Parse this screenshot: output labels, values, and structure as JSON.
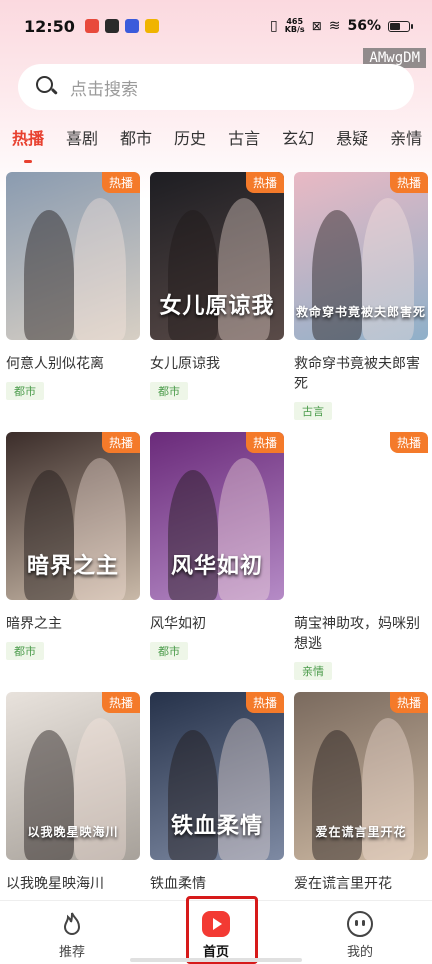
{
  "status_bar": {
    "time": "12:50",
    "net_speed_value": "465",
    "net_speed_unit": "KB/s",
    "battery_percent": "56%",
    "battery_level": 0.56
  },
  "watermark": "AMwgDM",
  "search": {
    "placeholder": "点击搜索"
  },
  "tabs": [
    "热播",
    "喜剧",
    "都市",
    "历史",
    "古言",
    "玄幻",
    "悬疑",
    "亲情"
  ],
  "active_tab": "热播",
  "hot_badge": "热播",
  "cards": [
    {
      "title": "何意人别似花离",
      "genre": "都市",
      "poster_text": "",
      "colors": [
        "#8a9bb0",
        "#d7cfc4"
      ]
    },
    {
      "title": "女儿原谅我",
      "genre": "都市",
      "poster_text": "女儿原谅我",
      "colors": [
        "#1d1d22",
        "#5a4b48"
      ]
    },
    {
      "title": "救命穿书竟被夫郎害死",
      "genre": "古言",
      "poster_text": "救命穿书竟被夫郎害死",
      "colors": [
        "#e9b9c4",
        "#8fb0c9"
      ]
    },
    {
      "title": "暗界之主",
      "genre": "都市",
      "poster_text": "暗界之主",
      "colors": [
        "#3b2d2a",
        "#c9b9a8"
      ]
    },
    {
      "title": "风华如初",
      "genre": "都市",
      "poster_text": "风华如初",
      "colors": [
        "#6a2a7a",
        "#b58bc6"
      ]
    },
    {
      "title": "萌宝神助攻，妈咪别想逃",
      "genre": "亲情",
      "poster_text": "",
      "colors": [
        "#ffffff",
        "#ffffff"
      ]
    },
    {
      "title": "以我晚星映海川",
      "genre": "",
      "poster_text": "以我晚星映海川",
      "colors": [
        "#e8e2dc",
        "#a7a19a"
      ]
    },
    {
      "title": "铁血柔情",
      "genre": "",
      "poster_text": "铁血柔情",
      "colors": [
        "#26324a",
        "#7e8aa3"
      ]
    },
    {
      "title": "爱在谎言里开花",
      "genre": "",
      "poster_text": "爱在谎言里开花",
      "colors": [
        "#7a6a5e",
        "#cdb9a3"
      ]
    }
  ],
  "bottom_nav": [
    {
      "label": "推荐",
      "icon": "flame-icon"
    },
    {
      "label": "首页",
      "icon": "play-icon"
    },
    {
      "label": "我的",
      "icon": "smile-icon"
    }
  ],
  "accent_color": "#e8402f"
}
